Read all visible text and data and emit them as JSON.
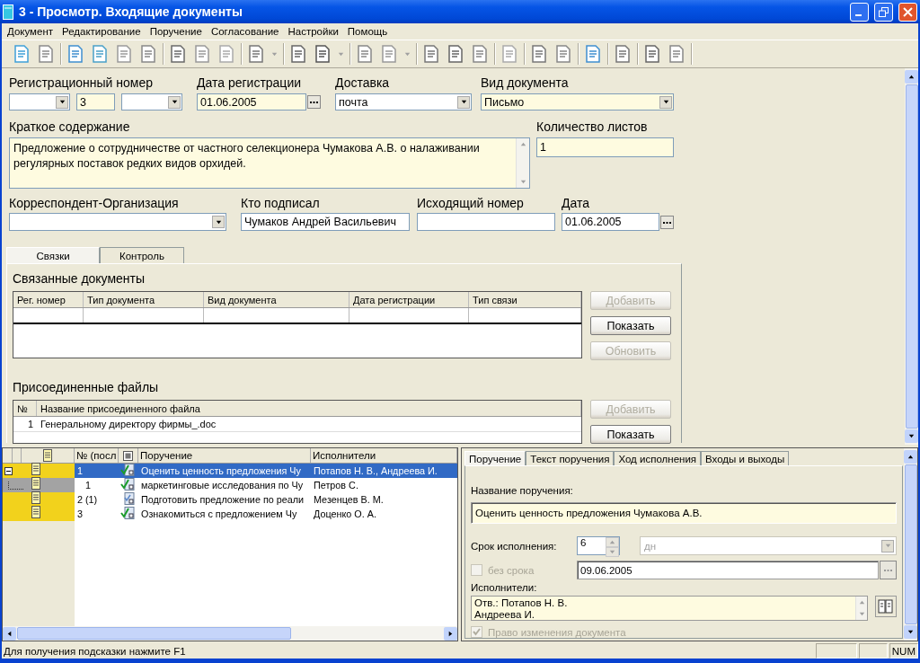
{
  "window": {
    "title": "3 - Просмотр. Входящие документы"
  },
  "menu": [
    "Документ",
    "Редактирование",
    "Поручение",
    "Согласование",
    "Настройки",
    "Помощь"
  ],
  "form": {
    "rows": [
      {
        "groups": [
          {
            "label": "Регистрационный номер",
            "fields": [
              {
                "kind": "combo",
                "highlighted": false
              },
              {
                "kind": "text",
                "value": "3",
                "highlighted": true
              },
              {
                "kind": "combo",
                "highlighted": false
              }
            ]
          },
          {
            "label": "Дата регистрации",
            "fields": [
              {
                "kind": "date",
                "value": "01.06.2005",
                "highlighted": true
              }
            ]
          },
          {
            "label": "Доставка",
            "fields": [
              {
                "kind": "combo",
                "value": "почта",
                "highlighted": false
              }
            ]
          },
          {
            "label": "Вид документа",
            "fields": [
              {
                "kind": "combo",
                "value": "Письмо",
                "highlighted": true
              }
            ]
          }
        ]
      },
      {
        "groups": [
          {
            "label": "Краткое содержание",
            "fields": [
              {
                "kind": "textarea",
                "value": "Предложение о сотрудничестве от частного селекционера Чумакова А.В. о налаживании регулярных поставок редких видов орхидей.",
                "highlighted": true
              }
            ]
          },
          {
            "label": "Количество листов",
            "fields": [
              {
                "kind": "text",
                "value": "1",
                "highlighted": true
              }
            ]
          }
        ]
      },
      {
        "groups": [
          {
            "label": "Корреспондент-Организация",
            "fields": [
              {
                "kind": "combo",
                "highlighted": false
              }
            ]
          },
          {
            "label": "Кто подписал",
            "fields": [
              {
                "kind": "text",
                "value": "Чумаков Андрей Васильевич",
                "highlighted": false
              }
            ]
          },
          {
            "label": "Исходящий номер",
            "fields": [
              {
                "kind": "text",
                "highlighted": false
              }
            ]
          },
          {
            "label": "Дата",
            "fields": [
              {
                "kind": "date",
                "value": "01.06.2005",
                "highlighted": false
              }
            ]
          }
        ]
      }
    ]
  },
  "doc_tabs": [
    {
      "label": "Связки",
      "selected": true
    },
    {
      "label": "Контроль",
      "selected": false
    }
  ],
  "linked_documents": {
    "title": "Связанные документы",
    "columns": [
      "Рег. номер",
      "Тип документа",
      "Вид документа",
      "Дата регистрации",
      "Тип связи"
    ],
    "buttons": [
      {
        "label": "Добавить",
        "disabled": true
      },
      {
        "label": "Показать",
        "disabled": false
      },
      {
        "label": "Обновить",
        "disabled": true
      }
    ]
  },
  "attached_files": {
    "title": "Присоединенные файлы",
    "columns": [
      "№",
      "Название присоединенного файла"
    ],
    "rows": [
      [
        "1",
        "Генеральному директору фирмы_.doc"
      ]
    ],
    "buttons": [
      {
        "label": "Добавить",
        "disabled": true
      },
      {
        "label": "Показать",
        "disabled": false
      }
    ]
  },
  "tasks": {
    "columns": [
      "№ (посл",
      "Поручение",
      "Исполнители"
    ],
    "rows": [
      {
        "number": "1",
        "title": "Оценить ценность предложения Чу",
        "executors": "Потапов Н. В., Андреева И.",
        "selected": true,
        "expanded": true,
        "checked": true,
        "color": "#f2d21c",
        "children": [
          {
            "number": "1",
            "title": "маркетинговые исследования по Чу",
            "executors": "Петров С.",
            "selected": false,
            "checked": true,
            "color": "#a3a3a3"
          }
        ]
      },
      {
        "number": "2 (1)",
        "title": "Подготовить предложение по реали",
        "executors": "Мезенцев В. М.",
        "selected": false,
        "checked": false,
        "color": "#f2d21c"
      },
      {
        "number": "3",
        "title": "Ознакомиться с предложением Чу",
        "executors": "Доценко О. А.",
        "selected": false,
        "checked": true,
        "color": "#f2d21c"
      }
    ]
  },
  "task_detail": {
    "tabs": [
      {
        "label": "Поручение",
        "selected": true
      },
      {
        "label": "Текст поручения",
        "selected": false
      },
      {
        "label": "Ход исполнения",
        "selected": false
      },
      {
        "label": "Входы и выходы",
        "selected": false
      }
    ],
    "name_label": "Название поручения:",
    "name_value": "Оценить ценность предложения Чумакова А.В.",
    "term_label": "Срок исполнения:",
    "term_value": "6",
    "unit": {
      "value": "дн",
      "disabled": true
    },
    "no_term": {
      "label": "без срока",
      "checked": false,
      "disabled": true
    },
    "due_date": "09.06.2005",
    "executors_label": "Исполнители:",
    "executors_lines": [
      "Отв.: Потапов Н. В.",
      "Андреева И."
    ],
    "edit_right": {
      "label": "Право изменения документа",
      "checked": true,
      "disabled": true
    }
  },
  "status_bar": {
    "hint": "Для получения подсказки нажмите F1",
    "indicators": [
      "NUM"
    ]
  }
}
